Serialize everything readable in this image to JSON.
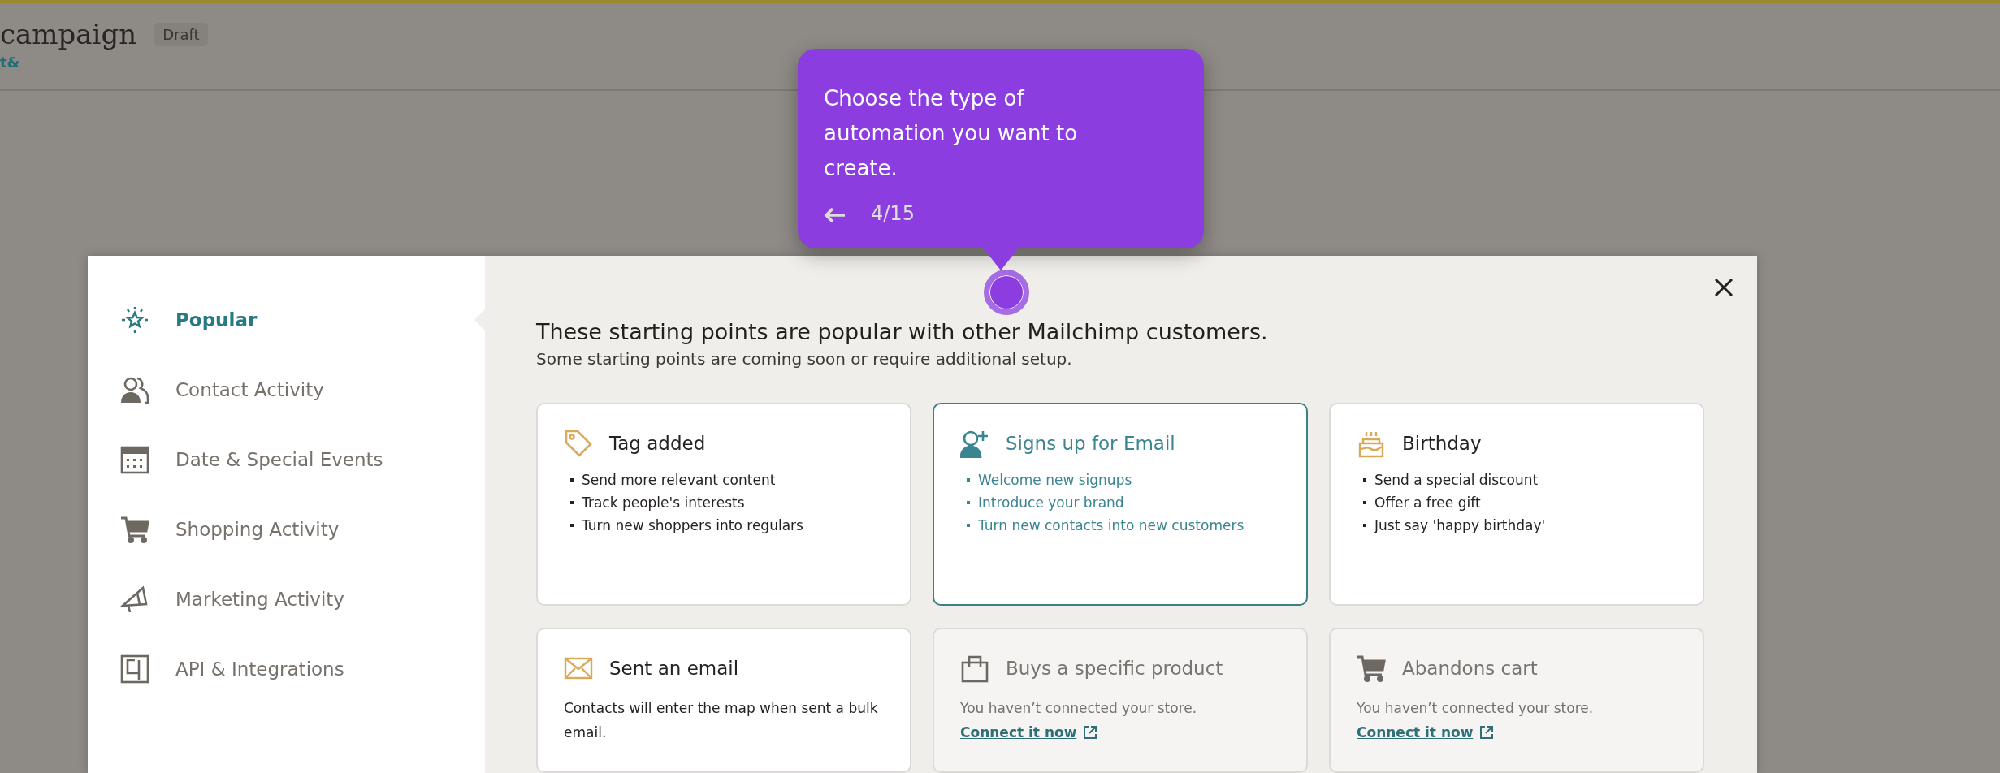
{
  "header": {
    "title": "campaign",
    "status": "Draft",
    "link": "t&"
  },
  "tour": {
    "text": "Choose the type of automation you want to create.",
    "step": "4/15"
  },
  "sidebar": {
    "items": [
      {
        "label": "Popular",
        "kind": "sparkle",
        "selected": true
      },
      {
        "label": "Contact Activity",
        "kind": "people",
        "selected": false
      },
      {
        "label": "Date & Special Events",
        "kind": "calendar",
        "selected": false
      },
      {
        "label": "Shopping Activity",
        "kind": "cart",
        "selected": false
      },
      {
        "label": "Marketing Activity",
        "kind": "megaphone",
        "selected": false
      },
      {
        "label": "API & Integrations",
        "kind": "plug",
        "selected": false
      }
    ]
  },
  "content": {
    "heading": "These starting points are popular with other Mailchimp customers.",
    "subheading": "Some starting points are coming soon or require additional setup.",
    "cards": [
      {
        "title": "Tag added",
        "kind": "tag",
        "selected": false,
        "disabled": false,
        "bullets": [
          "Send more relevant content",
          "Track people's interests",
          "Turn new shoppers into regulars"
        ]
      },
      {
        "title": "Signs up for Email",
        "kind": "signup",
        "selected": true,
        "disabled": false,
        "bullets": [
          "Welcome new signups",
          "Introduce your brand",
          "Turn new contacts into new customers"
        ]
      },
      {
        "title": "Birthday",
        "kind": "cake",
        "selected": false,
        "disabled": false,
        "bullets": [
          "Send a special discount",
          "Offer a free gift",
          "Just say 'happy birthday'"
        ]
      },
      {
        "title": "Sent an email",
        "kind": "envelope",
        "selected": false,
        "disabled": false,
        "description": "Contacts will enter the map when sent a bulk email."
      },
      {
        "title": "Buys a specific product",
        "kind": "bag",
        "selected": false,
        "disabled": true,
        "description": "You haven’t connected your store.",
        "link": "Connect it now"
      },
      {
        "title": "Abandons cart",
        "kind": "cart",
        "selected": false,
        "disabled": true,
        "description": "You haven’t connected your store.",
        "link": "Connect it now"
      }
    ]
  }
}
